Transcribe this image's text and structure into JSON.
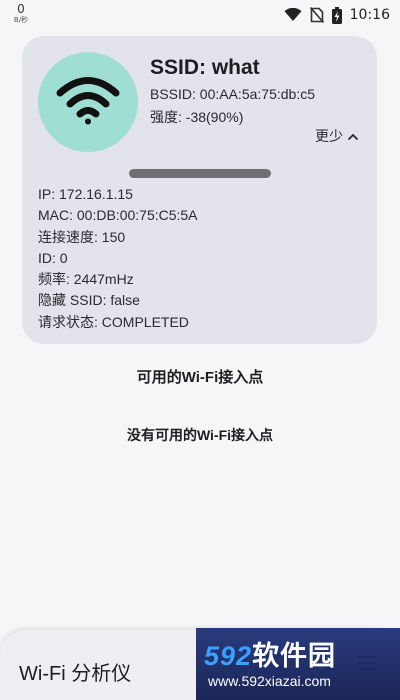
{
  "status_bar": {
    "net_speed_value": "0",
    "net_speed_unit": "B/秒",
    "time": "10:16",
    "icons": [
      "wifi-signal-icon",
      "no-sim-icon",
      "battery-charging-icon"
    ]
  },
  "wifi_card": {
    "icon": "wifi-icon",
    "accent_color": "#9fded3",
    "ssid": "SSID: what",
    "bssid": "BSSID: 00:AA:5a:75:db:c5",
    "strength": "强度: -38(90%)",
    "toggle_label": "更少",
    "details": [
      "IP: 172.16.1.15",
      "MAC: 00:DB:00:75:C5:5A",
      "连接速度: 150",
      "ID: 0",
      "频率: 2447mHz",
      "隐藏 SSID: false",
      "请求状态: COMPLETED"
    ]
  },
  "access_points": {
    "title": "可用的Wi-Fi接入点",
    "empty_message": "没有可用的Wi-Fi接入点"
  },
  "bottom_bar": {
    "app_title": "Wi-Fi 分析仪",
    "actions": [
      "filter-icon",
      "sort-icon",
      "menu-icon"
    ]
  },
  "watermark": {
    "logo_text": "592",
    "logo_cn": "软件园",
    "url": "www.592xiazai.com"
  }
}
